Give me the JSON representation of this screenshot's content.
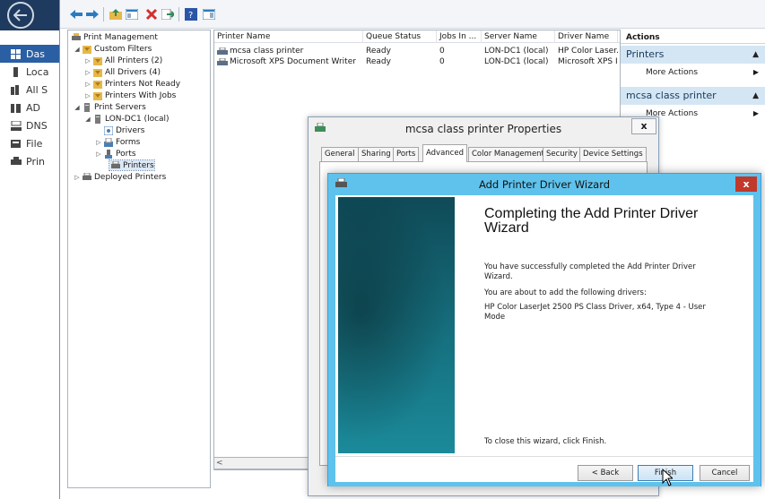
{
  "sidebar": {
    "items": [
      {
        "label": "Das",
        "icon": "grid-icon"
      },
      {
        "label": "Loca",
        "icon": "server-icon"
      },
      {
        "label": "All S",
        "icon": "servers-icon"
      },
      {
        "label": "AD",
        "icon": "ad-icon"
      },
      {
        "label": "DNS",
        "icon": "dns-icon"
      },
      {
        "label": "File",
        "icon": "file-icon"
      },
      {
        "label": "Prin",
        "icon": "printer-icon"
      }
    ]
  },
  "tree": {
    "root": "Print Management",
    "custom_filters": "Custom Filters",
    "all_printers": "All Printers (2)",
    "all_drivers": "All Drivers (4)",
    "printers_not_ready": "Printers Not Ready",
    "printers_with_jobs": "Printers With Jobs",
    "print_servers": "Print Servers",
    "server": "LON-DC1 (local)",
    "drivers": "Drivers",
    "forms": "Forms",
    "ports": "Ports",
    "printers": "Printers",
    "deployed_printers": "Deployed Printers"
  },
  "list": {
    "columns": [
      "Printer Name",
      "Queue Status",
      "Jobs In ...",
      "Server Name",
      "Driver Name"
    ],
    "rows": [
      [
        "mcsa class printer",
        "Ready",
        "0",
        "LON-DC1 (local)",
        "HP Color Laser."
      ],
      [
        "Microsoft XPS Document Writer",
        "Ready",
        "0",
        "LON-DC1 (local)",
        "Microsoft XPS I"
      ]
    ]
  },
  "actions": {
    "title": "Actions",
    "group1": "Printers",
    "group1_more": "More Actions",
    "group2": "mcsa class printer",
    "group2_more": "More Actions"
  },
  "properties": {
    "title": "mcsa class printer Properties",
    "close": "x",
    "tabs": [
      "General",
      "Sharing",
      "Ports",
      "Advanced",
      "Color Management",
      "Security",
      "Device Settings"
    ],
    "active_tab": "Advanced"
  },
  "wizard": {
    "title": "Add Printer Driver Wizard",
    "close": "x",
    "heading_line1": "Completing the Add Printer Driver",
    "heading_line2": "Wizard",
    "success_text": "You have successfully completed the Add Printer Driver Wizard.",
    "about_text": "You are about to add the following drivers:",
    "driver_text": "HP Color LaserJet 2500 PS Class Driver, x64, Type 4 - User Mode",
    "finish_note": "To close this wizard, click Finish.",
    "back_label": "< Back",
    "finish_label": "Finish",
    "cancel_label": "Cancel"
  },
  "colors": {
    "accent": "#5fc2ec",
    "sidebar_active": "#2a5fa3",
    "close_red": "#c0392b"
  }
}
